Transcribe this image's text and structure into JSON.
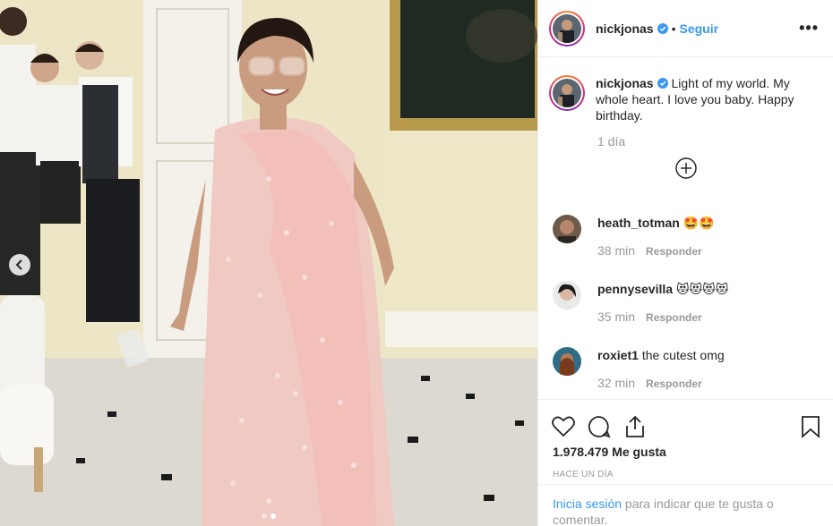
{
  "post": {
    "username": "nickjonas",
    "follow_label": "Seguir",
    "separator": "•",
    "more_label": "•••"
  },
  "caption": {
    "username": "nickjonas",
    "text": "Light of my world. My whole heart. I love you baby. Happy birthday.",
    "time": "1 día"
  },
  "comments": [
    {
      "username": "heath_totman",
      "text": "🤩🤩",
      "time": "38 min",
      "reply": "Responder"
    },
    {
      "username": "pennysevilla",
      "text": "😻😻😻😻",
      "time": "35 min",
      "reply": "Responder"
    },
    {
      "username": "roxiet1",
      "text": "the cutest omg",
      "time": "32 min",
      "reply": "Responder"
    }
  ],
  "stats": {
    "likes": "1.978.479 Me gusta",
    "ago": "HACE UN DÍA"
  },
  "login": {
    "link": "Inicia sesión",
    "rest": " para indicar que te gusta o comentar."
  },
  "carousel": {
    "slide_count": 2,
    "active_index": 0
  },
  "colors": {
    "accent": "#3897f0",
    "muted": "#999999",
    "text": "#262626"
  }
}
